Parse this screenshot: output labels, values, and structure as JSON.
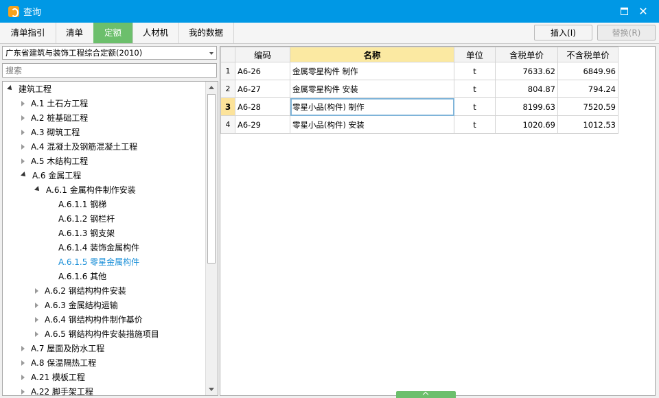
{
  "window": {
    "title": "查询"
  },
  "tabs": [
    {
      "label": "清单指引",
      "active": false
    },
    {
      "label": "清单",
      "active": false
    },
    {
      "label": "定额",
      "active": true
    },
    {
      "label": "人材机",
      "active": false
    },
    {
      "label": "我的数据",
      "active": false
    }
  ],
  "toolbar": {
    "insert_label": "插入(I)",
    "replace_label": "替换(R)"
  },
  "left_panel": {
    "quota_library": "广东省建筑与装饰工程综合定额(2010)",
    "search_placeholder": "搜索",
    "tree": [
      {
        "label": "建筑工程",
        "expander": "expanded"
      },
      {
        "label": "A.1 土石方工程",
        "expander": "collapsed"
      },
      {
        "label": "A.2 桩基础工程",
        "expander": "collapsed"
      },
      {
        "label": "A.3 砌筑工程",
        "expander": "collapsed"
      },
      {
        "label": "A.4 混凝土及钢筋混凝土工程",
        "expander": "collapsed"
      },
      {
        "label": "A.5 木结构工程",
        "expander": "collapsed"
      },
      {
        "label": "A.6 金属工程",
        "expander": "expanded"
      },
      {
        "label": "A.6.1 金属构件制作安装",
        "expander": "expanded"
      },
      {
        "label": "A.6.1.1 钢梯",
        "expander": "none"
      },
      {
        "label": "A.6.1.2 钢栏杆",
        "expander": "none"
      },
      {
        "label": "A.6.1.3 钢支架",
        "expander": "none"
      },
      {
        "label": "A.6.1.4 装饰金属构件",
        "expander": "none"
      },
      {
        "label": "A.6.1.5 零星金属构件",
        "expander": "none",
        "selected": true
      },
      {
        "label": "A.6.1.6 其他",
        "expander": "none"
      },
      {
        "label": "A.6.2 钢结构构件安装",
        "expander": "collapsed"
      },
      {
        "label": "A.6.3 金属结构运输",
        "expander": "collapsed"
      },
      {
        "label": "A.6.4 钢结构构件制作基价",
        "expander": "collapsed"
      },
      {
        "label": "A.6.5 钢结构构件安装措施项目",
        "expander": "collapsed"
      },
      {
        "label": "A.7 屋面及防水工程",
        "expander": "collapsed"
      },
      {
        "label": "A.8 保温隔热工程",
        "expander": "collapsed"
      },
      {
        "label": "A.21 模板工程",
        "expander": "collapsed"
      },
      {
        "label": "A.22 脚手架工程",
        "expander": "collapsed"
      }
    ]
  },
  "grid": {
    "columns": [
      "",
      "编码",
      "名称",
      "单位",
      "含税单价",
      "不含税单价"
    ],
    "rows": [
      {
        "index": "1",
        "code": "A6-26",
        "name": "金属零星构件 制作",
        "unit": "t",
        "price_with_tax": "7633.62",
        "price_without_tax": "6849.96"
      },
      {
        "index": "2",
        "code": "A6-27",
        "name": "金属零星构件 安装",
        "unit": "t",
        "price_with_tax": "804.87",
        "price_without_tax": "794.24"
      },
      {
        "index": "3",
        "code": "A6-28",
        "name": "零星小品(构件) 制作",
        "unit": "t",
        "price_with_tax": "8199.63",
        "price_without_tax": "7520.59",
        "current": true
      },
      {
        "index": "4",
        "code": "A6-29",
        "name": "零星小品(构件) 安装",
        "unit": "t",
        "price_with_tax": "1020.69",
        "price_without_tax": "1012.53"
      }
    ]
  },
  "colors": {
    "title_bar": "#0098e5",
    "active_tab": "#6cbf6c",
    "selected_tree_text": "#1a8fd8",
    "header_highlight": "#fbe9a2"
  }
}
